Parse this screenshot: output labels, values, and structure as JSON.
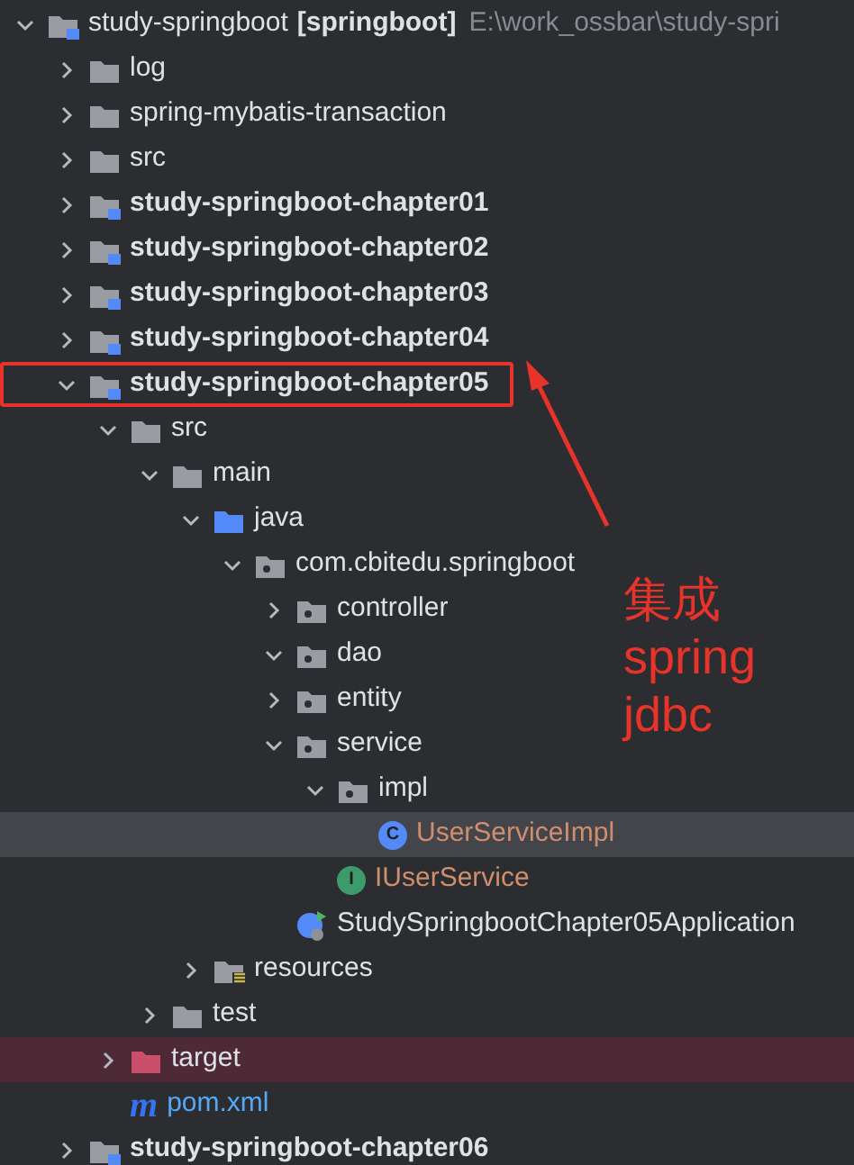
{
  "tree": [
    {
      "kind": "module",
      "label": "study-springboot",
      "module_tag": "[springboot]",
      "path": "E:\\work_ossbar\\study-spri",
      "expanded": true,
      "selected": false,
      "children": [
        {
          "kind": "folder",
          "label": "log",
          "expanded": false,
          "selected": false
        },
        {
          "kind": "folder",
          "label": "spring-mybatis-transaction",
          "expanded": false,
          "selected": false
        },
        {
          "kind": "folder",
          "label": "src",
          "expanded": false,
          "selected": false
        },
        {
          "kind": "module",
          "label": "study-springboot-chapter01",
          "expanded": false,
          "selected": false
        },
        {
          "kind": "module",
          "label": "study-springboot-chapter02",
          "expanded": false,
          "selected": false
        },
        {
          "kind": "module",
          "label": "study-springboot-chapter03",
          "expanded": false,
          "selected": false
        },
        {
          "kind": "module",
          "label": "study-springboot-chapter04",
          "expanded": false,
          "selected": false
        },
        {
          "kind": "module",
          "label": "study-springboot-chapter05",
          "expanded": true,
          "selected": false,
          "annotated": true,
          "children": [
            {
              "kind": "folder",
              "label": "src",
              "expanded": true,
              "selected": false,
              "children": [
                {
                  "kind": "folder",
                  "label": "main",
                  "expanded": true,
                  "selected": false,
                  "children": [
                    {
                      "kind": "source",
                      "label": "java",
                      "expanded": true,
                      "selected": false,
                      "children": [
                        {
                          "kind": "package",
                          "label": "com.cbitedu.springboot",
                          "expanded": true,
                          "selected": false,
                          "children": [
                            {
                              "kind": "package",
                              "label": "controller",
                              "expanded": false,
                              "selected": false
                            },
                            {
                              "kind": "package",
                              "label": "dao",
                              "expanded": true,
                              "selected": false
                            },
                            {
                              "kind": "package",
                              "label": "entity",
                              "expanded": false,
                              "selected": false
                            },
                            {
                              "kind": "package",
                              "label": "service",
                              "expanded": true,
                              "selected": false,
                              "children": [
                                {
                                  "kind": "package",
                                  "label": "impl",
                                  "expanded": true,
                                  "selected": false,
                                  "children": [
                                    {
                                      "kind": "class",
                                      "icon_letter": "C",
                                      "label": "UserServiceImpl",
                                      "selected": true
                                    }
                                  ]
                                },
                                {
                                  "kind": "interface",
                                  "icon_letter": "I",
                                  "label": "IUserService",
                                  "selected": false
                                }
                              ]
                            },
                            {
                              "kind": "app",
                              "label": "StudySpringbootChapter05Application",
                              "selected": false
                            }
                          ]
                        }
                      ]
                    },
                    {
                      "kind": "resources",
                      "label": "resources",
                      "expanded": false,
                      "selected": false
                    }
                  ]
                },
                {
                  "kind": "folder",
                  "label": "test",
                  "expanded": false,
                  "selected": false
                }
              ]
            },
            {
              "kind": "excluded",
              "label": "target",
              "expanded": false,
              "selected": false
            },
            {
              "kind": "maven",
              "icon_letter": "m",
              "label": "pom.xml",
              "selected": false
            }
          ]
        },
        {
          "kind": "module",
          "label": "study-springboot-chapter06",
          "expanded": false,
          "selected": false
        }
      ]
    }
  ],
  "annotation": {
    "lines": [
      "集成",
      "spring",
      "jdbc"
    ]
  }
}
